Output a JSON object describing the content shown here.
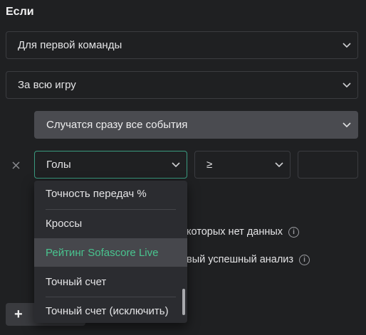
{
  "condition": {
    "title": "Если",
    "team_select": {
      "value": "Для первой команды"
    },
    "period_select": {
      "value": "За всю игру"
    },
    "events_select": {
      "value": "Случатся сразу все события"
    },
    "metric_select": {
      "value": "Голы"
    },
    "operator_select": {
      "value": "≥"
    },
    "value_input": {
      "value": ""
    },
    "remove_icon": "close-icon",
    "dropdown": {
      "items": [
        {
          "label": "Точность передач %"
        },
        {
          "label": "Кроссы"
        },
        {
          "label": "Рейтинг Sofascore Live",
          "active": true
        },
        {
          "label": "Точный счет"
        },
        {
          "label": "Точный счет (исключить)"
        }
      ]
    },
    "options": {
      "row1_partial": "которых нет данных",
      "row2_partial": "вый успешный анализ"
    },
    "add_button": {
      "label": "+"
    }
  },
  "colors": {
    "background": "#1f2022",
    "active_border": "#3a9a7f",
    "active_text": "#49c48f",
    "highlight": "#46474c"
  }
}
